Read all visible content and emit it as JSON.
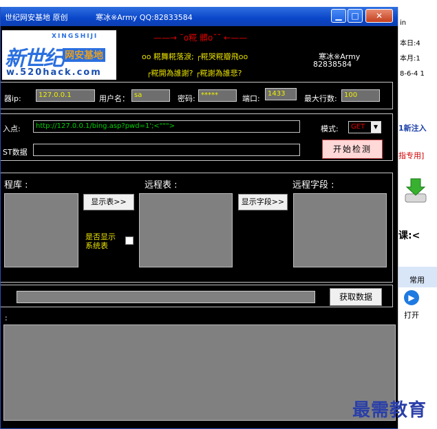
{
  "window": {
    "title": "世纪网安基地 原创",
    "author": "寒冰※Army QQ:82833584",
    "min": "▁",
    "max": "□",
    "close": "✕"
  },
  "banner": {
    "logo_big": "新世纪",
    "logo_small": "网安基地",
    "logo_pinyin": "XINGSHIJI",
    "logo_url": "w.520hack.com",
    "deco": "——→ ˘o糀 髒o˘˘ ←——",
    "line1": "oo 糀舞糀落淚; ┌糀哭糀瓣飛oo",
    "line2": "┌糀開為誰謝? ┌糀謝為誰悲?",
    "author_name": "寒冰※Army",
    "author_qq": "82838584"
  },
  "conn": {
    "server_label": "器ip:",
    "server": "127.0.0.1",
    "user_label": "用户名：",
    "user": "sa",
    "pass_label": "密码:",
    "pass": "*****",
    "port_label": "端口:",
    "port": "1433",
    "rows_label": "最大行数:",
    "rows": "100"
  },
  "inject": {
    "point_label": "入点:",
    "url": "http://127.0.0.1/bing.asp?pwd=1';<\"\"\">",
    "mode_label": "模式:",
    "mode": "GET",
    "post_label": "ST数据",
    "start_button": "开始检测"
  },
  "remote": {
    "db_label": "程库 :",
    "table_label": "远程表 :",
    "field_label": "远程字段 :",
    "show_table": "显示表>>",
    "show_field": "显示字段>>",
    "sys_label1": "是否显示",
    "sys_label2": "系统表"
  },
  "fetch": {
    "button": "获取数据",
    "result_label": ":"
  },
  "sidepane": {
    "l1": "in",
    "l2": "本日:4",
    "l3": "本月:1",
    "l4": "8-6-4 1",
    "l5": "1新注入",
    "l6": "指专用]",
    "l7": "课:<",
    "l8": "常用",
    "l9": "打开"
  },
  "watermark": "最需教育"
}
